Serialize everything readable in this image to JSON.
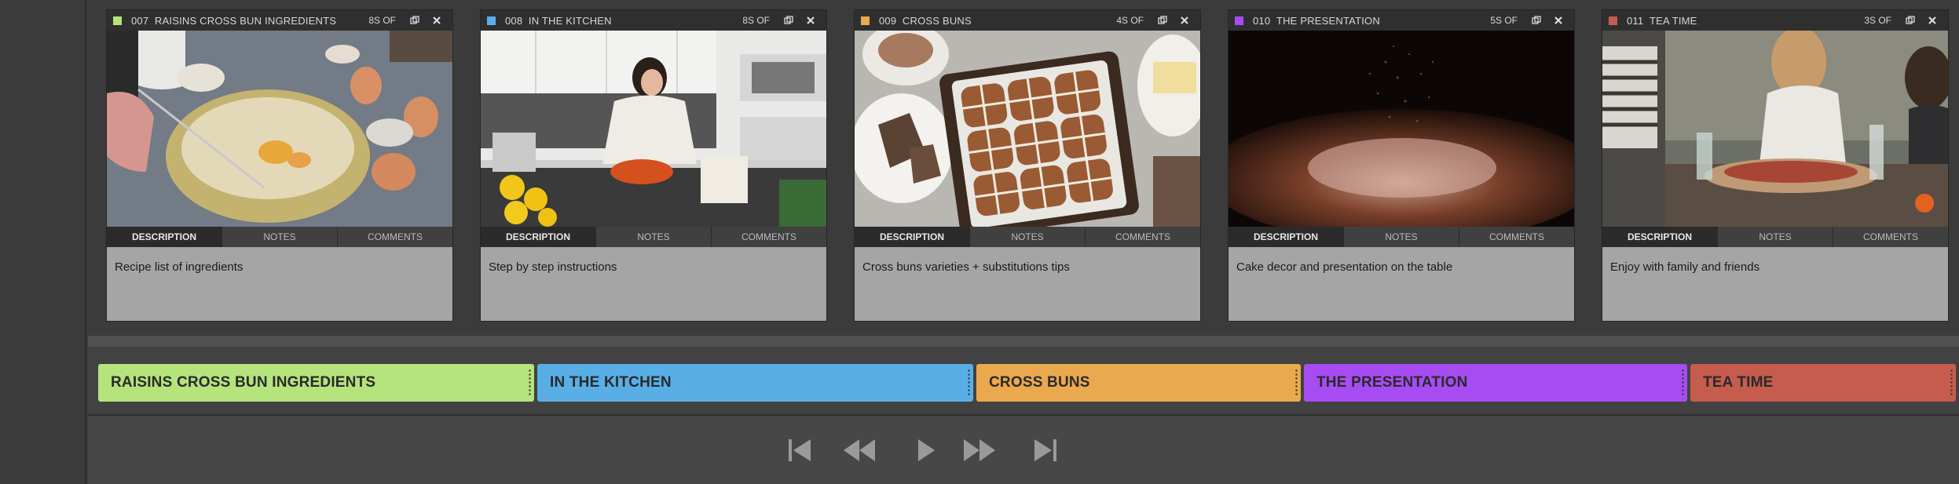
{
  "cards": [
    {
      "number": "007",
      "title": "RAISINS CROSS BUN INGREDIENTS",
      "duration": "8S OF",
      "color": "#b5e37c",
      "tabs": [
        "DESCRIPTION",
        "NOTES",
        "COMMENTS"
      ],
      "active_tab": "DESCRIPTION",
      "description": "Recipe list of ingredients",
      "thumbnail": "mixing-bowl-with-eggs-and-flour"
    },
    {
      "number": "008",
      "title": "IN THE KITCHEN",
      "duration": "8S OF",
      "color": "#59afe5",
      "tabs": [
        "DESCRIPTION",
        "NOTES",
        "COMMENTS"
      ],
      "active_tab": "DESCRIPTION",
      "description": "Step by step instructions",
      "thumbnail": "woman-cooking-in-kitchen"
    },
    {
      "number": "009",
      "title": "CROSS BUNS",
      "duration": "4S OF",
      "color": "#eaa94e",
      "tabs": [
        "DESCRIPTION",
        "NOTES",
        "COMMENTS"
      ],
      "active_tab": "DESCRIPTION",
      "description": "Cross buns varieties + substitutions tips",
      "thumbnail": "tray-of-hot-cross-buns"
    },
    {
      "number": "010",
      "title": "THE PRESENTATION",
      "duration": "5S OF",
      "color": "#a74cf3",
      "tabs": [
        "DESCRIPTION",
        "NOTES",
        "COMMENTS"
      ],
      "active_tab": "DESCRIPTION",
      "description": "Cake decor and presentation on the table",
      "thumbnail": "cocoa-dusting-on-cake"
    },
    {
      "number": "011",
      "title": "TEA TIME",
      "duration": "3S OF",
      "color": "#c55c4e",
      "tabs": [
        "DESCRIPTION",
        "NOTES",
        "COMMENTS"
      ],
      "active_tab": "DESCRIPTION",
      "description": "Enjoy with family and friends",
      "thumbnail": "friends-at-table"
    }
  ],
  "timeline": {
    "clips": [
      {
        "label": "RAISINS CROSS BUN INGREDIENTS",
        "color": "#b5e37c"
      },
      {
        "label": "IN THE KITCHEN",
        "color": "#59afe5"
      },
      {
        "label": "CROSS BUNS",
        "color": "#eaa94e"
      },
      {
        "label": "THE PRESENTATION",
        "color": "#a74cf3"
      },
      {
        "label": "TEA TIME",
        "color": "#c55c4e"
      }
    ]
  },
  "transport": {
    "buttons": [
      "skip-to-start-icon",
      "rewind-icon",
      "play-icon",
      "fast-forward-icon",
      "skip-to-end-icon"
    ]
  }
}
